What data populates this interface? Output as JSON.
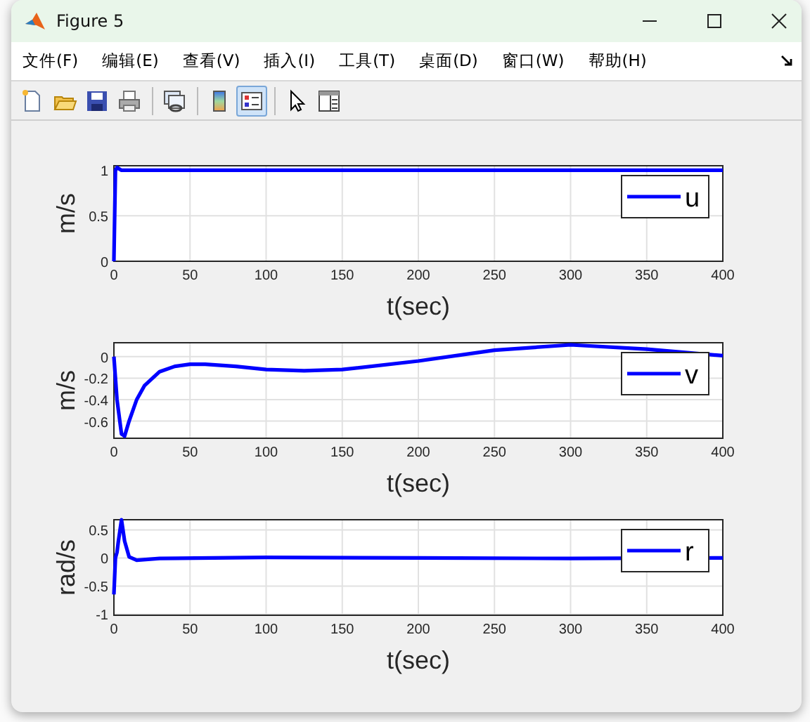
{
  "window": {
    "title": "Figure 5"
  },
  "menu": [
    {
      "label": "文件(F)"
    },
    {
      "label": "编辑(E)"
    },
    {
      "label": "查看(V)"
    },
    {
      "label": "插入(I)"
    },
    {
      "label": "工具(T)"
    },
    {
      "label": "桌面(D)"
    },
    {
      "label": "窗口(W)"
    },
    {
      "label": "帮助(H)"
    }
  ],
  "toolbar": [
    {
      "kind": "new",
      "pressed": false
    },
    {
      "kind": "open",
      "pressed": false
    },
    {
      "kind": "save",
      "pressed": false
    },
    {
      "kind": "print",
      "pressed": false
    },
    {
      "kind": "separator"
    },
    {
      "kind": "link",
      "pressed": false
    },
    {
      "kind": "separator"
    },
    {
      "kind": "colorbar",
      "pressed": false
    },
    {
      "kind": "legend",
      "pressed": true
    },
    {
      "kind": "separator"
    },
    {
      "kind": "pointer",
      "pressed": false
    },
    {
      "kind": "inspector",
      "pressed": false
    }
  ],
  "plots": [
    {
      "chart_data": {
        "type": "line",
        "grid": true,
        "xlabel": "t(sec)",
        "ylabel": "m/s",
        "xlim": [
          0,
          400
        ],
        "ylim": [
          0,
          1.05
        ],
        "xticks": [
          0,
          50,
          100,
          150,
          200,
          250,
          300,
          350,
          400
        ],
        "yticks": [
          0,
          0.5,
          1
        ],
        "x": [
          0,
          1,
          2,
          3,
          5,
          10,
          400
        ],
        "series": [
          {
            "name": "u",
            "color": "#0000ff",
            "values": [
              0,
              1.0,
              1.03,
              1.02,
              1.0,
              1.0,
              1.0
            ]
          }
        ]
      }
    },
    {
      "chart_data": {
        "type": "line",
        "grid": true,
        "xlabel": "t(sec)",
        "ylabel": "m/s",
        "xlim": [
          0,
          400
        ],
        "ylim": [
          -0.76,
          0.13
        ],
        "xticks": [
          0,
          50,
          100,
          150,
          200,
          250,
          300,
          350,
          400
        ],
        "yticks": [
          {
            "value": -0.6,
            "label": "-0.6"
          },
          {
            "value": -0.4,
            "label": "-0.4"
          },
          {
            "value": -0.2,
            "label": "-0.2"
          },
          0
        ],
        "x": [
          0,
          2,
          5,
          7,
          10,
          15,
          20,
          30,
          40,
          50,
          60,
          80,
          100,
          125,
          150,
          200,
          250,
          300,
          350,
          400
        ],
        "series": [
          {
            "name": "v",
            "color": "#0000ff",
            "values": [
              0,
              -0.4,
              -0.72,
              -0.74,
              -0.6,
              -0.4,
              -0.27,
              -0.14,
              -0.09,
              -0.07,
              -0.07,
              -0.09,
              -0.12,
              -0.13,
              -0.12,
              -0.04,
              0.06,
              0.11,
              0.07,
              0.01
            ]
          }
        ]
      }
    },
    {
      "chart_data": {
        "type": "line",
        "grid": true,
        "xlabel": "t(sec)",
        "ylabel": "rad/s",
        "xlim": [
          0,
          400
        ],
        "ylim": [
          -1.02,
          0.68
        ],
        "xticks": [
          0,
          50,
          100,
          150,
          200,
          250,
          300,
          350,
          400
        ],
        "yticks": [
          -1,
          {
            "value": -0.5,
            "label": "-0.5"
          },
          0,
          {
            "value": 0.5,
            "label": "0.5"
          }
        ],
        "x": [
          0,
          1,
          2,
          3,
          5,
          7,
          10,
          15,
          30,
          100,
          200,
          300,
          400
        ],
        "series": [
          {
            "name": "r",
            "color": "#0000ff",
            "values": [
              -0.65,
              0,
              0.1,
              0.3,
              0.68,
              0.3,
              0.02,
              -0.04,
              -0.01,
              0.01,
              0,
              -0.01,
              0
            ]
          }
        ]
      }
    }
  ]
}
